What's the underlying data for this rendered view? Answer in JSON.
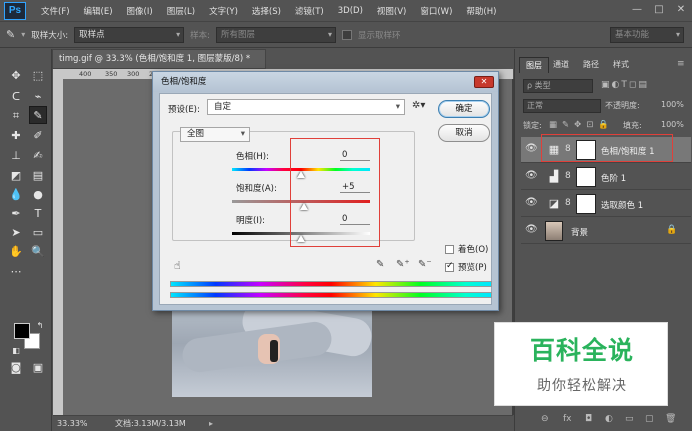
{
  "menubar": {
    "logo": "Ps",
    "items": [
      "文件(F)",
      "编辑(E)",
      "图像(I)",
      "图层(L)",
      "文字(Y)",
      "选择(S)",
      "滤镜(T)",
      "3D(D)",
      "视图(V)",
      "窗口(W)",
      "帮助(H)"
    ],
    "window_controls": [
      "—",
      "□",
      "✕"
    ]
  },
  "options": {
    "sample_size_label": "取样大小:",
    "sample_size_value": "取样点",
    "sample_label": "样本:",
    "sample_value": "所有图层",
    "show_ring_label": "显示取样环",
    "workspace": "基本功能"
  },
  "document": {
    "tab_title": "timg.gif @ 33.3% (色相/饱和度 1, 图层蒙版/8) *",
    "ruler_ticks": [
      "400",
      "350",
      "300",
      "250"
    ],
    "zoom": "33.33%",
    "doc_size": "文档:3.13M/3.13M"
  },
  "dialog": {
    "title": "色相/饱和度",
    "preset_label": "预设(E):",
    "preset_value": "自定",
    "ok": "确定",
    "cancel": "取消",
    "edit_range": "全图",
    "hue_label": "色相(H):",
    "hue_value": "0",
    "saturation_label": "饱和度(A):",
    "saturation_value": "+5",
    "lightness_label": "明度(I):",
    "lightness_value": "0",
    "colorize_label": "着色(O)",
    "preview_label": "预览(P)",
    "colorize_checked": false,
    "preview_checked": true,
    "hue_level": 0.5,
    "saturation_level": 0.52,
    "lightness_level": 0.5
  },
  "layers_panel": {
    "tabs": [
      "图层",
      "通道",
      "路径",
      "样式"
    ],
    "filter_kind": "ρ 类型",
    "blend_mode": "正常",
    "opacity_label": "不透明度:",
    "opacity_value": "100%",
    "lock_label": "锁定:",
    "fill_label": "填充:",
    "fill_value": "100%",
    "layers": [
      {
        "name": "色相/饱和度 1",
        "selected": true
      },
      {
        "name": "色阶 1",
        "selected": false
      },
      {
        "name": "选取颜色 1",
        "selected": false
      },
      {
        "name": "背景",
        "selected": false
      }
    ],
    "footer_icons": [
      "link-icon",
      "fx-icon",
      "mask-icon",
      "adjustment-icon",
      "folder-icon",
      "new-layer-icon",
      "trash-icon"
    ],
    "footer_glyphs": [
      "⊖",
      "fx",
      "◘",
      "◐",
      "▭",
      "▢",
      "🗑"
    ]
  },
  "watermark": {
    "main": "百科全说",
    "sub": "助你轻松解决"
  },
  "colors": {
    "highlight_border": "#e0403a",
    "watermark_green": "#2ab35c"
  }
}
